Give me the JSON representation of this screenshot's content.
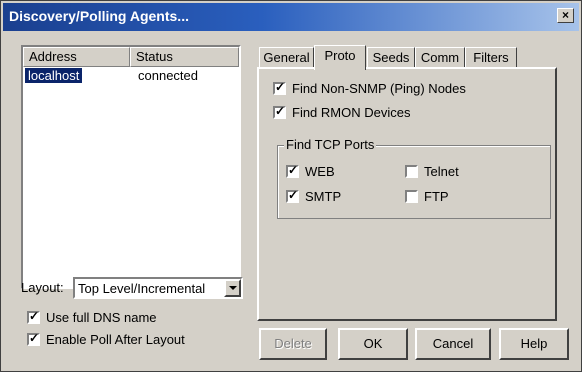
{
  "window": {
    "title": "Discovery/Polling Agents...",
    "close_glyph": "×"
  },
  "agents_list": {
    "columns": [
      "Address",
      "Status"
    ],
    "rows": [
      {
        "address": "localhost",
        "status": "connected"
      }
    ]
  },
  "layout": {
    "label": "Layout:",
    "selected": "Top Level/Incremental"
  },
  "options": {
    "use_full_dns": {
      "label": "Use full DNS name",
      "checked": true
    },
    "enable_poll": {
      "label": "Enable Poll After Layout",
      "checked": true
    }
  },
  "tabs": [
    "General",
    "Proto",
    "Seeds",
    "Comm",
    "Filters"
  ],
  "active_tab": "Proto",
  "proto": {
    "find_non_snmp": {
      "label": "Find Non-SNMP (Ping) Nodes",
      "checked": true
    },
    "find_rmon": {
      "label": "Find RMON Devices",
      "checked": true
    },
    "tcp_group": {
      "title": "Find TCP Ports",
      "web": {
        "label": "WEB",
        "checked": true
      },
      "telnet": {
        "label": "Telnet",
        "checked": false
      },
      "smtp": {
        "label": "SMTP",
        "checked": true
      },
      "ftp": {
        "label": "FTP",
        "checked": false
      }
    }
  },
  "buttons": {
    "delete": "Delete",
    "ok": "OK",
    "cancel": "Cancel",
    "help": "Help"
  },
  "check_glyph": "✓"
}
